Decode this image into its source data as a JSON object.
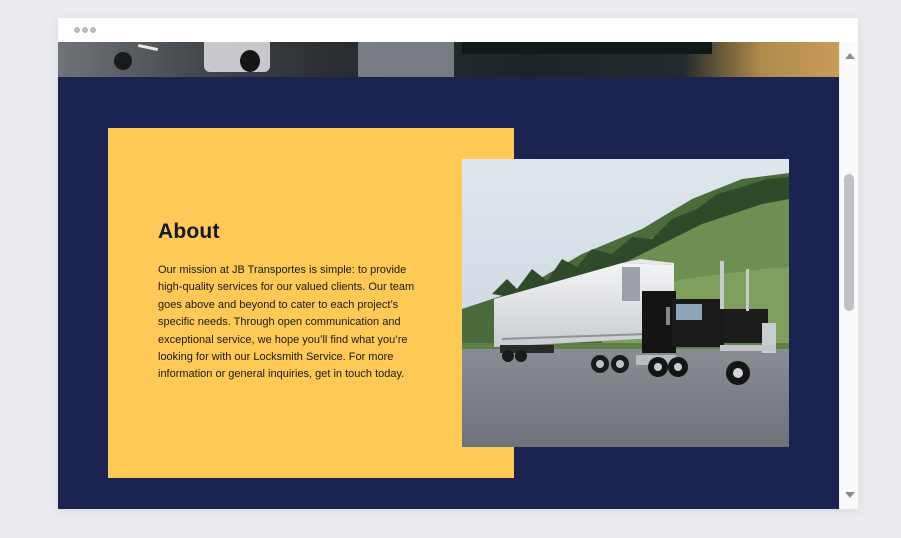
{
  "about": {
    "title": "About",
    "body": "Our mission at JB Transportes is simple: to provide high-quality services for our valued clients. Our team goes above and beyond to cater to each project’s specific needs. Through open communication and exceptional service, we hope you’ll find what you’re looking for with our Locksmith Service. For more information or general inquiries, get in touch today."
  },
  "colors": {
    "section_background": "#1b2350",
    "card_background": "#fec954",
    "text": "#1a1a1a"
  },
  "icons": {
    "window_controls": "dots-icon",
    "scroll_up": "triangle-up-icon",
    "scroll_down": "triangle-down-icon"
  }
}
